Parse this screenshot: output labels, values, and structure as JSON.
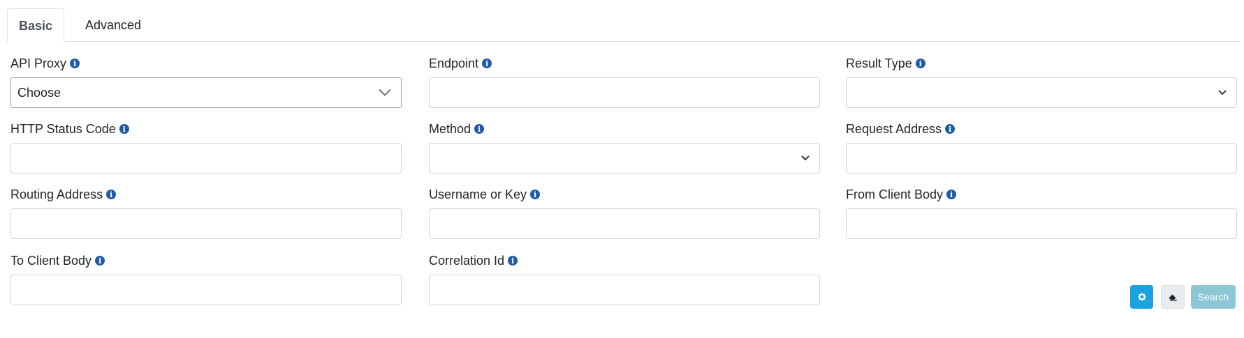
{
  "tabs": {
    "basic": "Basic",
    "advanced": "Advanced"
  },
  "fields": {
    "api_proxy": {
      "label": "API Proxy",
      "value": "Choose"
    },
    "endpoint": {
      "label": "Endpoint",
      "value": ""
    },
    "result_type": {
      "label": "Result Type",
      "value": ""
    },
    "http_status_code": {
      "label": "HTTP Status Code",
      "value": ""
    },
    "method": {
      "label": "Method",
      "value": ""
    },
    "request_address": {
      "label": "Request Address",
      "value": ""
    },
    "routing_address": {
      "label": "Routing Address",
      "value": ""
    },
    "username_or_key": {
      "label": "Username or Key",
      "value": ""
    },
    "from_client_body": {
      "label": "From Client Body",
      "value": ""
    },
    "to_client_body": {
      "label": "To Client Body",
      "value": ""
    },
    "correlation_id": {
      "label": "Correlation Id",
      "value": ""
    }
  },
  "buttons": {
    "search": "Search"
  },
  "icons": {
    "info": "info-icon",
    "settings": "gear-icon",
    "clear": "eraser-icon"
  },
  "colors": {
    "accent": "#1ba2e0",
    "info": "#1e5aa8",
    "search_button": "#8dc7d6"
  }
}
